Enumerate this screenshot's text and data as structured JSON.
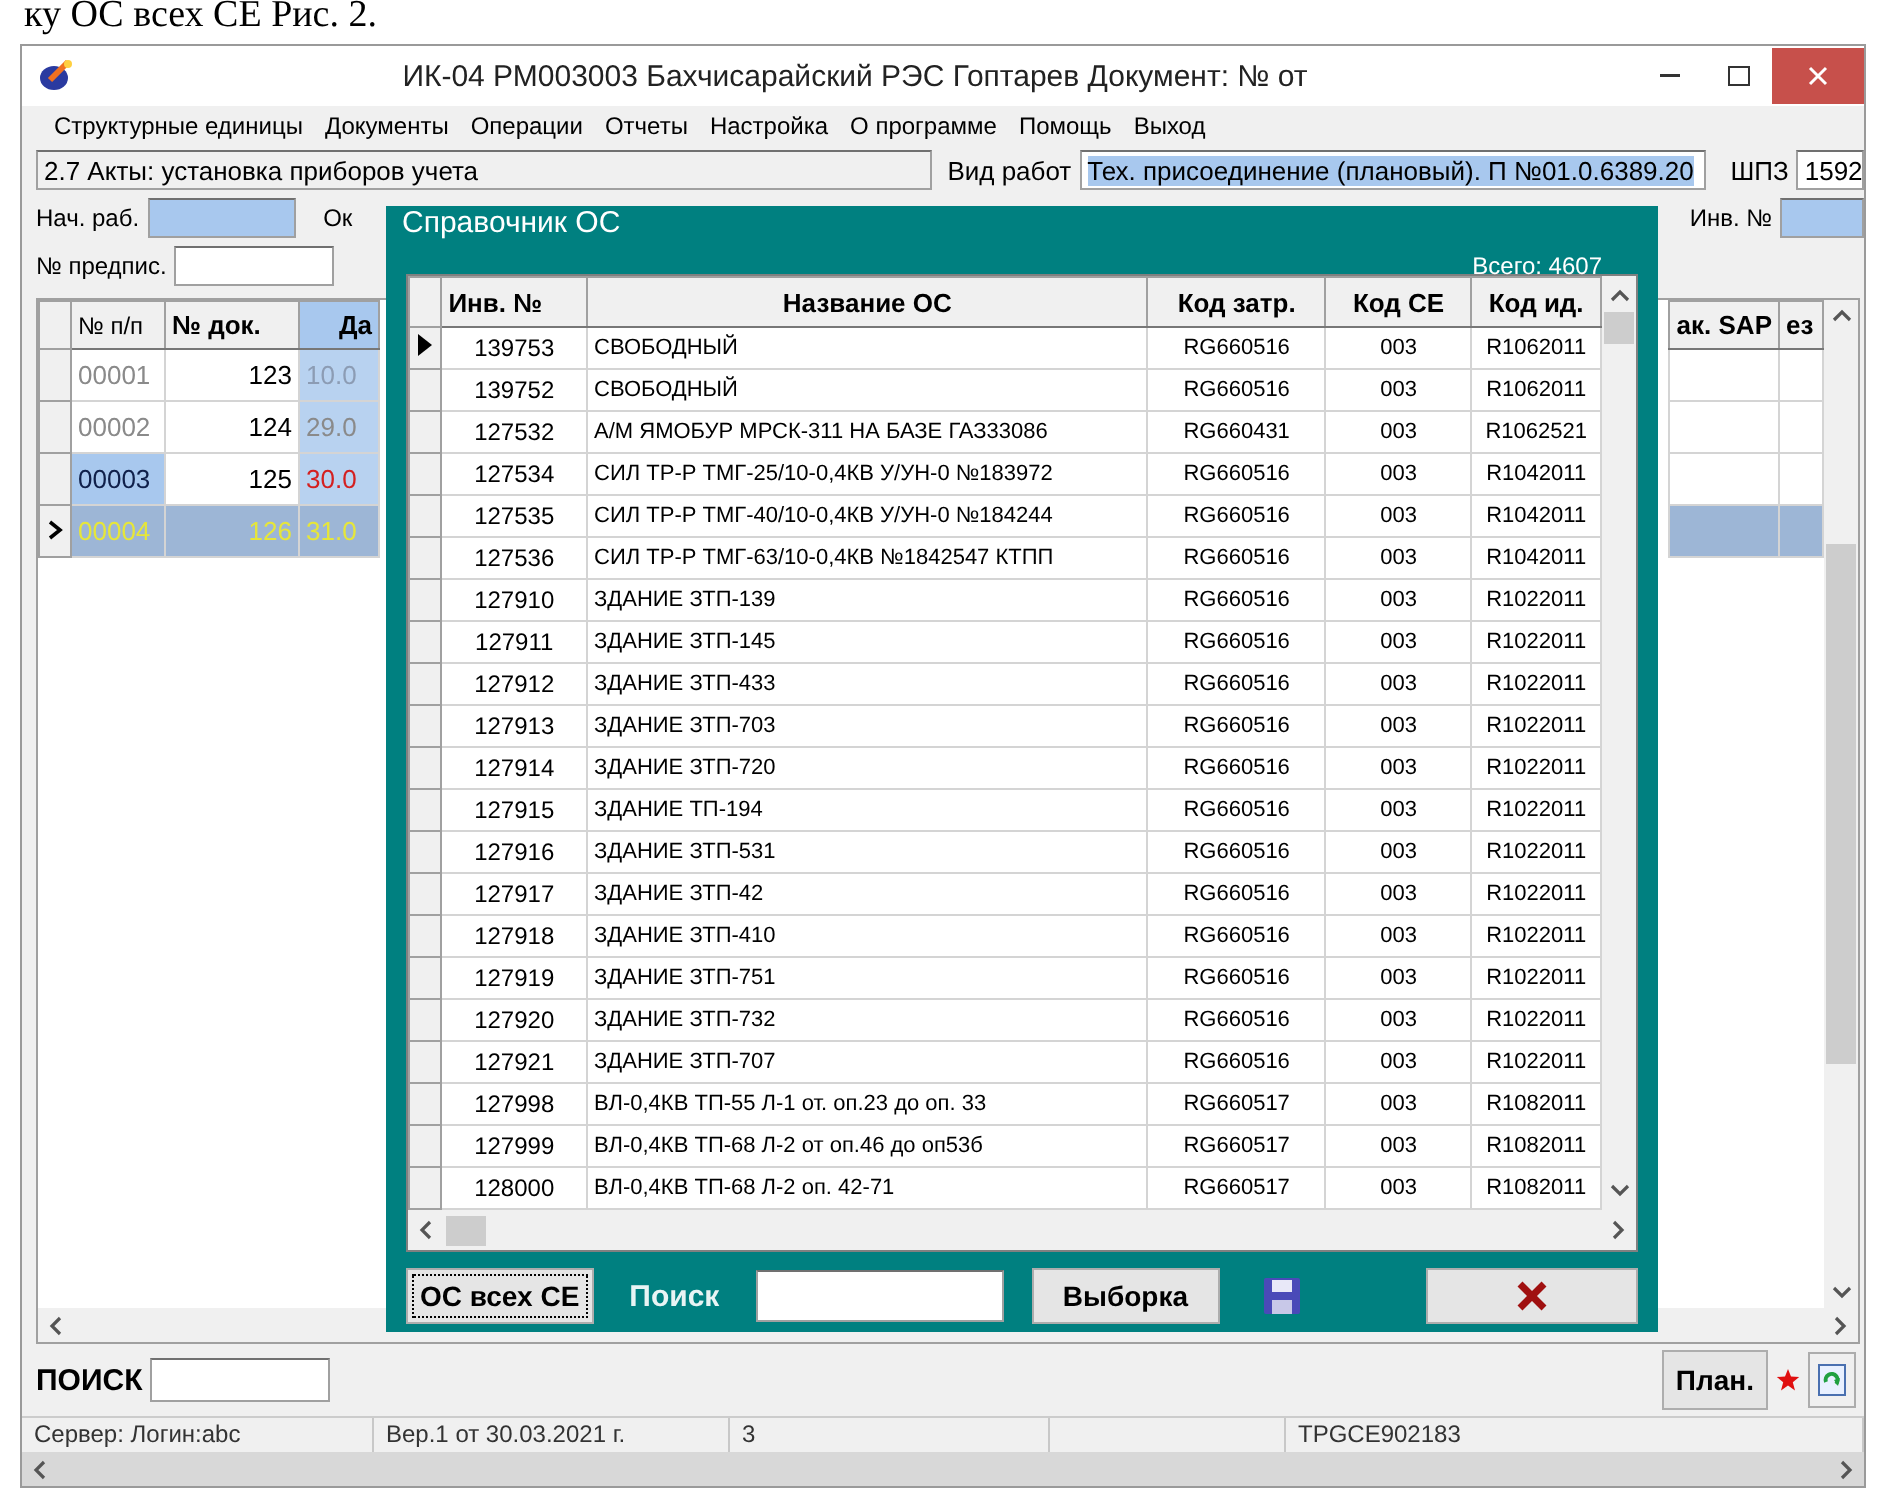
{
  "document_caption": "ку ОС всех СЕ Рис. 2.",
  "window": {
    "title": "ИК-04 РМ003003 Бахчисарайский РЭС Гоптарев Документ: № от"
  },
  "menu": [
    "Структурные единицы",
    "Документы",
    "Операции",
    "Отчеты",
    "Настройка",
    "О программе",
    "Помощь",
    "Выход"
  ],
  "header": {
    "section": "2.7  Акты: установка приборов учета",
    "work_type_label": "Вид работ",
    "work_type": "Тех. присоединение (плановый). П №01.0.6389.20",
    "shpz_label": "ШПЗ",
    "shpz": "1592"
  },
  "filters": {
    "start_label": "Нач. раб.",
    "end_label": "Ок",
    "inv_label": "Инв. №",
    "order_label": "№ предпис."
  },
  "grid": {
    "columns": [
      "№ п/п",
      "№ док.",
      "Да"
    ],
    "right_columns": [
      "ак. SAP",
      "ез"
    ],
    "rows": [
      {
        "num": "00001",
        "doc": "123",
        "date": "10.0",
        "color": "#8c9cb4",
        "dimmed": true,
        "selected": false
      },
      {
        "num": "00002",
        "doc": "124",
        "date": "29.0",
        "color": "#8a8a8a",
        "dimmed": true,
        "selected": false
      },
      {
        "num": "00003",
        "doc": "125",
        "date": "30.0",
        "color": "#d42020",
        "dimmed": false,
        "selected": false
      },
      {
        "num": "00004",
        "doc": "126",
        "date": "31.0",
        "color": "#e6e63a",
        "dimmed": false,
        "selected": true
      }
    ]
  },
  "search": {
    "label": "ПОИСК"
  },
  "plan_button": "План.",
  "status_bar": [
    "Сервер:  Логин:abc",
    "Вер.1 от 30.03.2021 г.",
    "3",
    "TPGCE902183"
  ],
  "dialog": {
    "title": "Справочник ОС",
    "total": "Всего: 4607",
    "columns": [
      "Инв. №",
      "Название ОС",
      "Код затр.",
      "Код СЕ",
      "Код ид."
    ],
    "rows": [
      {
        "inv": "139753",
        "name": "СВОБОДНЫЙ",
        "cost": "RG660516",
        "unit": "003",
        "id": "R1062011",
        "selected": true
      },
      {
        "inv": "139752",
        "name": "СВОБОДНЫЙ",
        "cost": "RG660516",
        "unit": "003",
        "id": "R1062011",
        "selected": false
      },
      {
        "inv": "127532",
        "name": "А/М ЯМОБУР МРСК-311 НА БАЗЕ ГАЗ33086",
        "cost": "RG660431",
        "unit": "003",
        "id": "R1062521",
        "selected": false
      },
      {
        "inv": "127534",
        "name": "СИЛ ТР-Р ТМГ-25/10-0,4КВ У/УН-0 №183972",
        "cost": "RG660516",
        "unit": "003",
        "id": "R1042011",
        "selected": false
      },
      {
        "inv": "127535",
        "name": "СИЛ ТР-Р ТМГ-40/10-0,4КВ У/УН-0 №184244",
        "cost": "RG660516",
        "unit": "003",
        "id": "R1042011",
        "selected": false
      },
      {
        "inv": "127536",
        "name": "СИЛ ТР-Р ТМГ-63/10-0,4КВ №1842547 КТПП",
        "cost": "RG660516",
        "unit": "003",
        "id": "R1042011",
        "selected": false
      },
      {
        "inv": "127910",
        "name": "ЗДАНИЕ ЗТП-139",
        "cost": "RG660516",
        "unit": "003",
        "id": "R1022011",
        "selected": false
      },
      {
        "inv": "127911",
        "name": "ЗДАНИЕ ЗТП-145",
        "cost": "RG660516",
        "unit": "003",
        "id": "R1022011",
        "selected": false
      },
      {
        "inv": "127912",
        "name": "ЗДАНИЕ ЗТП-433",
        "cost": "RG660516",
        "unit": "003",
        "id": "R1022011",
        "selected": false
      },
      {
        "inv": "127913",
        "name": "ЗДАНИЕ ЗТП-703",
        "cost": "RG660516",
        "unit": "003",
        "id": "R1022011",
        "selected": false
      },
      {
        "inv": "127914",
        "name": "ЗДАНИЕ ЗТП-720",
        "cost": "RG660516",
        "unit": "003",
        "id": "R1022011",
        "selected": false
      },
      {
        "inv": "127915",
        "name": "ЗДАНИЕ ТП-194",
        "cost": "RG660516",
        "unit": "003",
        "id": "R1022011",
        "selected": false
      },
      {
        "inv": "127916",
        "name": "ЗДАНИЕ ЗТП-531",
        "cost": "RG660516",
        "unit": "003",
        "id": "R1022011",
        "selected": false
      },
      {
        "inv": "127917",
        "name": "ЗДАНИЕ ЗТП-42",
        "cost": "RG660516",
        "unit": "003",
        "id": "R1022011",
        "selected": false
      },
      {
        "inv": "127918",
        "name": "ЗДАНИЕ ЗТП-410",
        "cost": "RG660516",
        "unit": "003",
        "id": "R1022011",
        "selected": false
      },
      {
        "inv": "127919",
        "name": "ЗДАНИЕ ЗТП-751",
        "cost": "RG660516",
        "unit": "003",
        "id": "R1022011",
        "selected": false
      },
      {
        "inv": "127920",
        "name": "ЗДАНИЕ ЗТП-732",
        "cost": "RG660516",
        "unit": "003",
        "id": "R1022011",
        "selected": false
      },
      {
        "inv": "127921",
        "name": "ЗДАНИЕ ЗТП-707",
        "cost": "RG660516",
        "unit": "003",
        "id": "R1022011",
        "selected": false
      },
      {
        "inv": "127998",
        "name": "ВЛ-0,4КВ ТП-55 Л-1 от. оп.23 до оп. 33",
        "cost": "RG660517",
        "unit": "003",
        "id": "R1082011",
        "selected": false
      },
      {
        "inv": "127999",
        "name": "ВЛ-0,4КВ ТП-68 Л-2 от оп.46 до оп53б",
        "cost": "RG660517",
        "unit": "003",
        "id": "R1082011",
        "selected": false
      },
      {
        "inv": "128000",
        "name": "ВЛ-0,4КВ ТП-68 Л-2 оп. 42-71",
        "cost": "RG660517",
        "unit": "003",
        "id": "R1082011",
        "selected": false
      }
    ],
    "all_units_button": "ОС всех СЕ",
    "search_label": "Поиск",
    "select_button": "Выборка"
  }
}
